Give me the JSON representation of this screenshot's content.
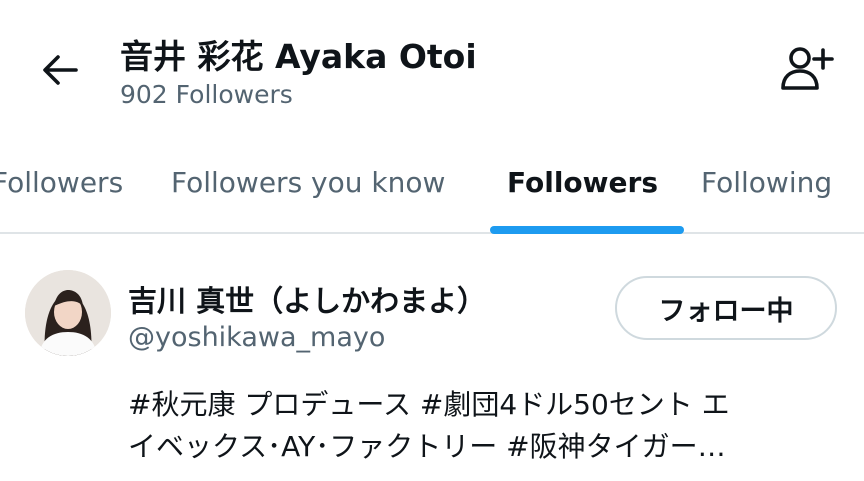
{
  "header": {
    "title": "音井 彩花 Ayaka Otoi",
    "subtitle": "902 Followers",
    "back_icon": "arrow-left-icon",
    "add_user_icon": "person-add-icon"
  },
  "tabs": [
    {
      "label": "Followers",
      "active": false
    },
    {
      "label": "Followers you know",
      "active": false
    },
    {
      "label": "Followers",
      "active": true
    },
    {
      "label": "Following",
      "active": false
    }
  ],
  "colors": {
    "accent": "#1d9bf0",
    "text_primary": "#0f1419",
    "text_secondary": "#536471",
    "divider": "#dfe4e7"
  },
  "users": [
    {
      "name": "吉川 真世（よしかわまよ）",
      "handle": "@yoshikawa_mayo",
      "follow_label": "フォロー中",
      "bio_lines": [
        "#秋元康 プロデュース #劇団4ドル50セント エ",
        "イベックス･AY･ファクトリー #阪神タイガー…"
      ]
    }
  ]
}
